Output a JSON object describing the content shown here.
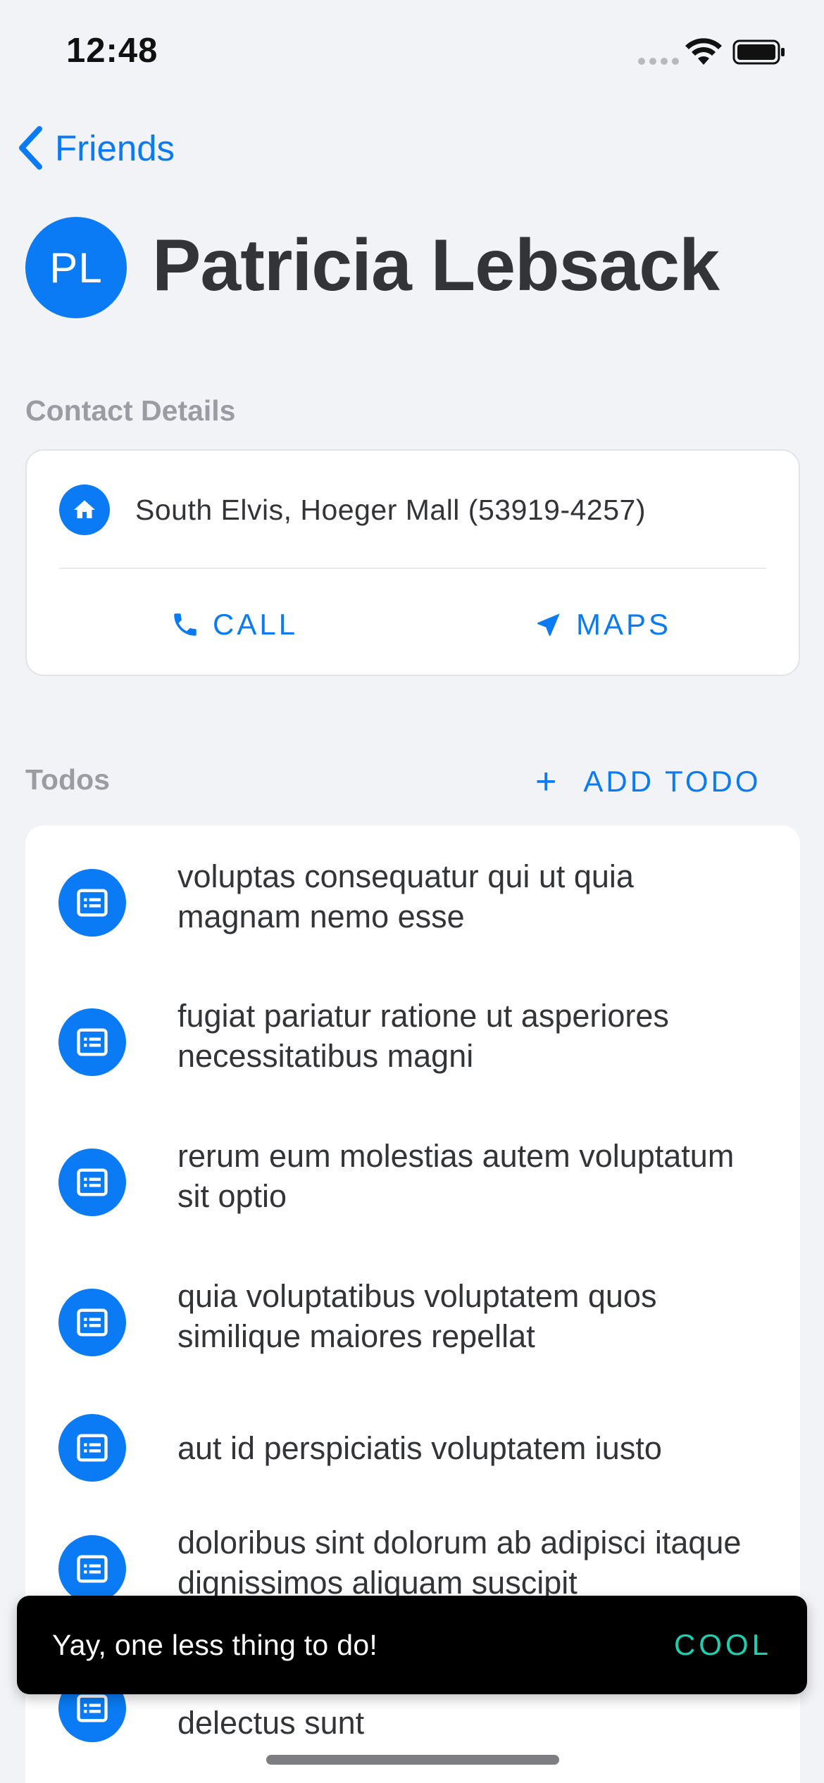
{
  "status_bar": {
    "time": "12:48"
  },
  "nav": {
    "back_label": "Friends"
  },
  "header": {
    "avatar_initials": "PL",
    "title": "Patricia Lebsack"
  },
  "contact": {
    "section_title": "Contact Details",
    "address": "South Elvis, Hoeger Mall (53919-4257)",
    "call_label": "CALL",
    "maps_label": "MAPS"
  },
  "todos": {
    "section_title": "Todos",
    "add_label": "ADD TODO",
    "add_icon": "+",
    "items": [
      {
        "text": "voluptas consequatur qui ut quia magnam nemo esse"
      },
      {
        "text": "fugiat pariatur ratione ut asperiores necessitatibus magni"
      },
      {
        "text": "rerum eum molestias autem voluptatum sit optio"
      },
      {
        "text": "quia voluptatibus voluptatem quos similique maiores repellat"
      },
      {
        "text": "aut id perspiciatis voluptatem iusto"
      },
      {
        "text": "doloribus sint dolorum ab adipisci itaque dignissimos aliquam suscipit"
      },
      {
        "text": "delectus sunt"
      }
    ]
  },
  "snackbar": {
    "message": "Yay, one less thing to do!",
    "action": "COOL"
  },
  "colors": {
    "accent": "#0a7bf4",
    "snackbar_action": "#1ad0b0",
    "background": "#f2f3f6"
  }
}
